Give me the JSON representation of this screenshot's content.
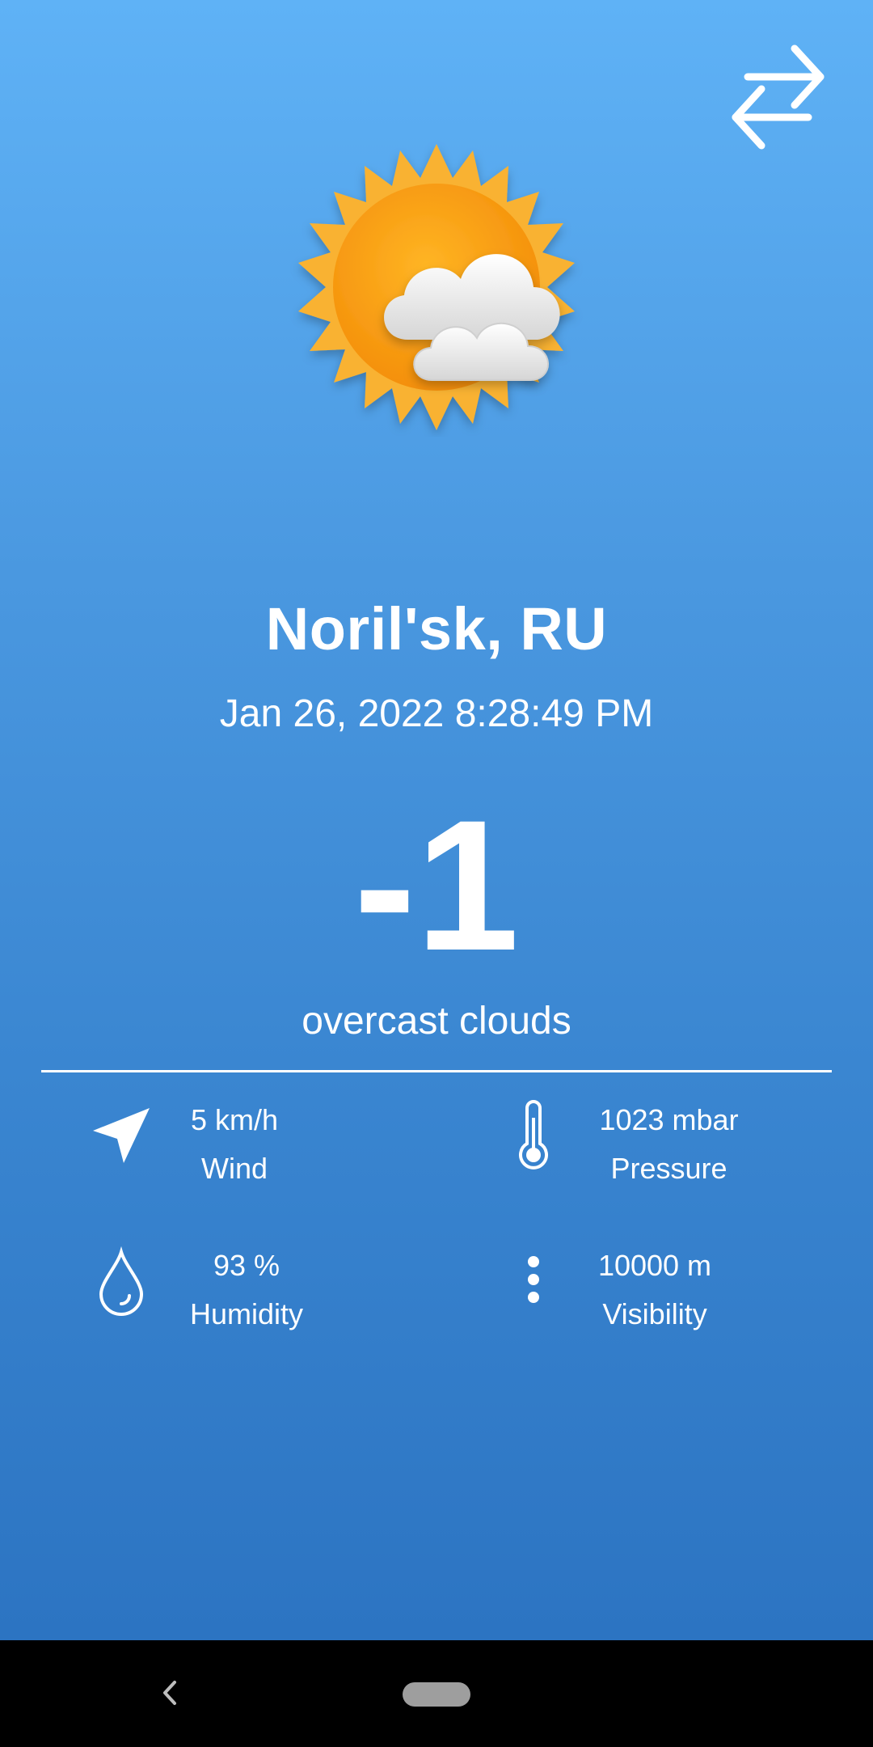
{
  "location": {
    "city": "Noril'sk, RU",
    "datetime": "Jan 26, 2022 8:28:49 PM"
  },
  "current": {
    "temperature": "-1",
    "description": "overcast clouds",
    "icon": "sun-with-clouds-icon"
  },
  "stats": {
    "wind": {
      "value": "5 km/h",
      "label": "Wind",
      "icon": "navigation-arrow-icon"
    },
    "pressure": {
      "value": "1023 mbar",
      "label": "Pressure",
      "icon": "thermometer-icon"
    },
    "humidity": {
      "value": "93 %",
      "label": "Humidity",
      "icon": "water-drop-icon"
    },
    "visibility": {
      "value": "10000 m",
      "label": "Visibility",
      "icon": "dots-vertical-icon"
    }
  },
  "toolbar": {
    "swap_icon": "swap-arrows-icon"
  },
  "navbar": {
    "back_icon": "back-chevron-icon",
    "home_icon": "home-pill-icon"
  },
  "colors": {
    "background_top": "#5fb2f6",
    "background_bottom": "#2c74c2",
    "text": "#ffffff",
    "sun": "#f7a51c",
    "navbar": "#000000"
  }
}
